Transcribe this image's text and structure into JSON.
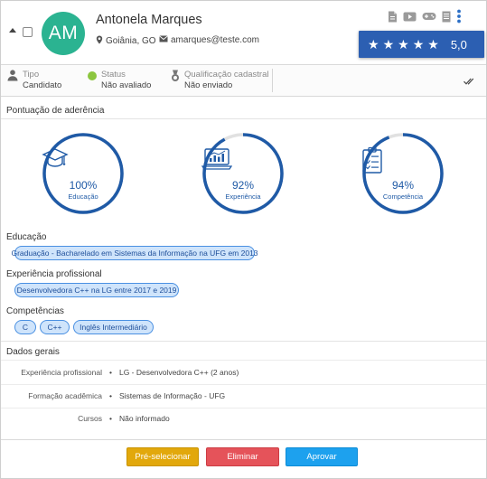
{
  "candidate": {
    "initials": "AM",
    "name": "Antonela Marques",
    "location": "Goiânia, GO",
    "email": "amarques@teste.com",
    "rating_value": 5,
    "rating_text": "5,0",
    "avatar_color": "#2bb391"
  },
  "header_icons": [
    "document-icon",
    "video-icon",
    "gamepad-icon",
    "file-icon",
    "more-vert-icon"
  ],
  "info": {
    "tipo_label": "Tipo",
    "tipo_value": "Candidato",
    "status_label": "Status",
    "status_value": "Não avaliado",
    "qual_label": "Qualificação cadastral",
    "qual_value": "Não enviado"
  },
  "score_section": {
    "title": "Pontuação de aderência",
    "gauges": [
      {
        "percent_label": "100%",
        "caption": "Educação",
        "value": 1.0
      },
      {
        "percent_label": "92%",
        "caption": "Experiência",
        "value": 0.92
      },
      {
        "percent_label": "94%",
        "caption": "Competência",
        "value": 0.94
      }
    ]
  },
  "education": {
    "title": "Educação",
    "tags": [
      "Graduação - Bacharelado em Sistemas da Informação na UFG em 2013"
    ]
  },
  "experience": {
    "title": "Experiência profissional",
    "tags": [
      "Desenvolvedora C++ na LG entre 2017 e 2019"
    ]
  },
  "skills": {
    "title": "Competências",
    "tags": [
      "C",
      "C++",
      "Inglês Intermediário"
    ]
  },
  "general": {
    "title": "Dados gerais",
    "rows": [
      {
        "label": "Experiência profissional",
        "value": "LG - Desenvolvedora C++ (2 anos)"
      },
      {
        "label": "Formação acadêmica",
        "value": "Sistemas de Informação - UFG"
      },
      {
        "label": "Cursos",
        "value": "Não informado"
      }
    ]
  },
  "actions": {
    "preselect": "Pré-selecionar",
    "eliminate": "Eliminar",
    "approve": "Aprovar"
  },
  "colors": {
    "accent": "#1f5aa6",
    "rating_bg": "#2c5fb2",
    "status_ok": "#8cc63f"
  }
}
